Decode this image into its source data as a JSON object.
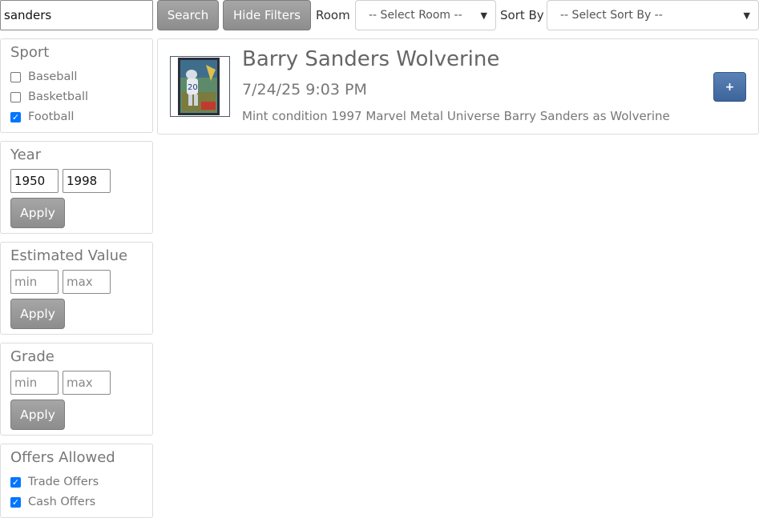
{
  "search": {
    "value": "sanders",
    "button_label": "Search",
    "hide_filters_label": "Hide Filters"
  },
  "room": {
    "label": "Room",
    "selected": "-- Select Room --"
  },
  "sort": {
    "label": "Sort By",
    "selected": "-- Select Sort By --"
  },
  "filters": {
    "sport": {
      "title": "Sport",
      "options": [
        {
          "label": "Baseball",
          "checked": false
        },
        {
          "label": "Basketball",
          "checked": false
        },
        {
          "label": "Football",
          "checked": true
        }
      ]
    },
    "year": {
      "title": "Year",
      "min_value": "1950",
      "max_value": "1998",
      "apply_label": "Apply"
    },
    "estimated_value": {
      "title": "Estimated Value",
      "min_placeholder": "min",
      "max_placeholder": "max",
      "apply_label": "Apply"
    },
    "grade": {
      "title": "Grade",
      "min_placeholder": "min",
      "max_placeholder": "max",
      "apply_label": "Apply"
    },
    "offers": {
      "title": "Offers Allowed",
      "options": [
        {
          "label": "Trade Offers",
          "checked": true
        },
        {
          "label": "Cash Offers",
          "checked": true
        }
      ]
    }
  },
  "results": [
    {
      "title": "Barry Sanders Wolverine",
      "date": "7/24/25 9:03 PM",
      "description": "Mint condition 1997 Marvel Metal Universe Barry Sanders as Wolverine",
      "action_label": "+"
    }
  ],
  "icons": {
    "chevron": "chevron-down-icon",
    "checkmark": "check-icon"
  },
  "colors": {
    "checkbox_checked": "#0075ff",
    "primary_button": "#4a72a8",
    "gray_button": "#999999"
  }
}
